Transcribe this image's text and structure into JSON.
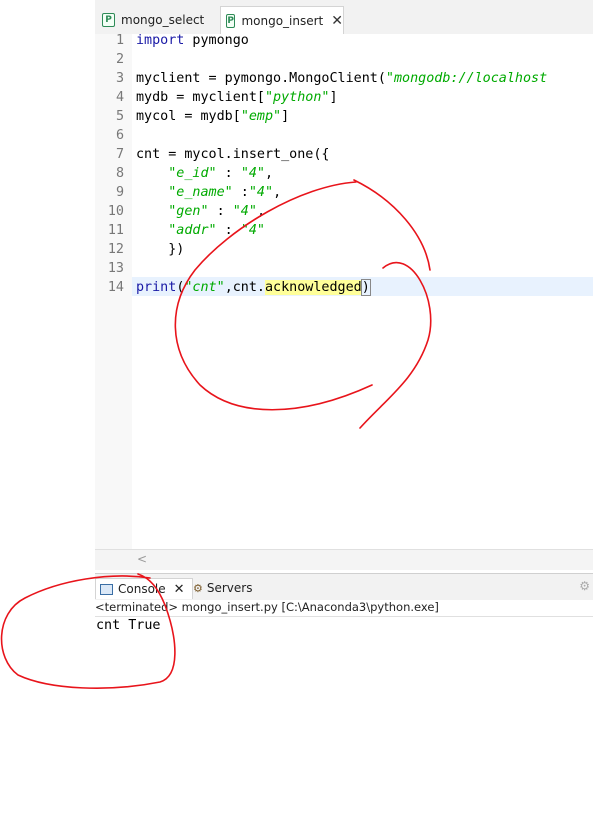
{
  "tabs": [
    {
      "label": "mongo_select",
      "icon": "python-file-icon",
      "active": false
    },
    {
      "label": "mongo_insert",
      "icon": "python-file-icon",
      "active": true
    }
  ],
  "editor": {
    "line_numbers": [
      "1",
      "2",
      "3",
      "4",
      "5",
      "6",
      "7",
      "8",
      "9",
      "10",
      "11",
      "12",
      "13",
      "14"
    ],
    "line1": {
      "kw": "import",
      "rest": " pymongo"
    },
    "line3": {
      "pre": "myclient = pymongo.MongoClient(",
      "str": "\"mongodb://localhost"
    },
    "line4": {
      "pre": "mydb = myclient[",
      "str": "\"python\"",
      "post": "]"
    },
    "line5": {
      "pre": "mycol = mydb[",
      "str": "\"emp\"",
      "post": "]"
    },
    "line7": {
      "text": "cnt = mycol.insert_one({"
    },
    "line8": {
      "indent": "    ",
      "key": "\"e_id\"",
      "sep": " : ",
      "val": "\"4\"",
      "post": ","
    },
    "line9": {
      "indent": "    ",
      "key": "\"e_name\"",
      "sep": " :",
      "val": "\"4\"",
      "post": ","
    },
    "line10": {
      "indent": "    ",
      "key": "\"gen\"",
      "sep": " : ",
      "val": "\"4\"",
      "post": ","
    },
    "line11": {
      "indent": "    ",
      "key": "\"addr\"",
      "sep": " : ",
      "val": "\"4\"",
      "post": ""
    },
    "line12": {
      "text": "    })"
    },
    "line14": {
      "kw": "print",
      "open": "(",
      "str": "\"cnt\"",
      "mid": ",cnt.",
      "hl": "acknowledged",
      "close": ")"
    }
  },
  "console": {
    "tabs": [
      {
        "label": "Console",
        "icon": "console-icon"
      },
      {
        "label": "Servers",
        "icon": "servers-icon"
      }
    ],
    "status": "<terminated> mongo_insert.py [C:\\Anaconda3\\python.exe]",
    "output": "cnt True"
  },
  "colors": {
    "annotation": "#e8141b",
    "keyword": "#1a1aa6",
    "string": "#00aa00",
    "highlight": "#ffff99"
  }
}
